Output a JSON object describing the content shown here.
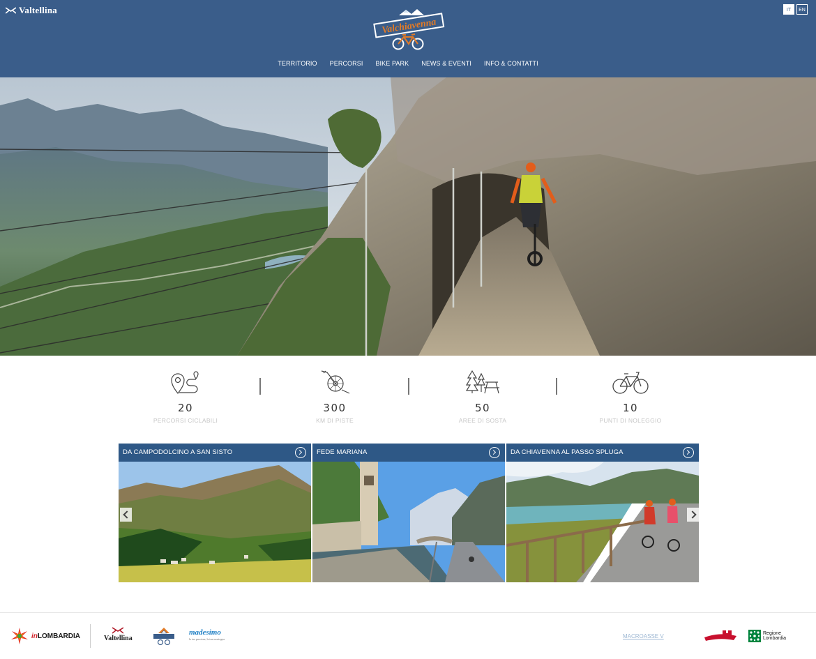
{
  "header": {
    "brand": "Valtellina",
    "logo_text": "Valchiavenna",
    "languages": [
      "IT",
      "EN"
    ],
    "nav": [
      "TERRITORIO",
      "PERCORSI",
      "BIKE PARK",
      "NEWS & EVENTI",
      "INFO & CONTATTI"
    ]
  },
  "stats": [
    {
      "icon": "route-pin-icon",
      "value": "20",
      "label": "PERCORSI CICLABILI"
    },
    {
      "icon": "mtb-wheel-icon",
      "value": "300",
      "label": "KM DI PISTE"
    },
    {
      "icon": "picnic-area-icon",
      "value": "50",
      "label": "AREE DI SOSTA"
    },
    {
      "icon": "bicycle-icon",
      "value": "10",
      "label": "PUNTI DI NOLEGGIO"
    }
  ],
  "routes": [
    {
      "title": "DA CAMPODOLCINO A SAN SISTO"
    },
    {
      "title": "FEDE MARIANA"
    },
    {
      "title": "DA CHIAVENNA AL PASSO SPLUGA"
    }
  ],
  "footer": {
    "inlombardia_in": "in",
    "inlombardia_rest": "LOMBARDIA",
    "valtellina": "Valtellina",
    "madesimo": "madesimo",
    "madesimo_tagline": "la tua passione, la tua montagna",
    "link": "MACROASSE V",
    "regione_1": "Regione",
    "regione_2": "Lombardia"
  },
  "colors": {
    "header_bg": "#3a5d8a",
    "card_bar": "#2e5886",
    "accent_orange": "#e27b27"
  }
}
